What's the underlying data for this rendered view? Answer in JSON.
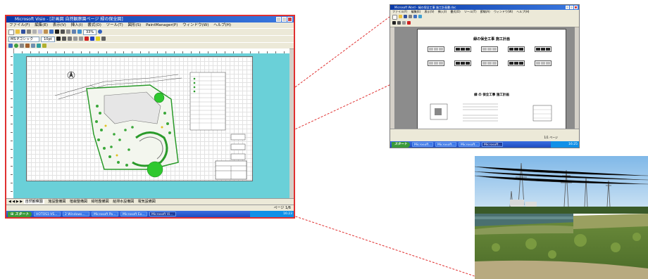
{
  "main_window": {
    "title": "Microsoft Visio - [計画図 自然観察園ページ 緑の保全図]",
    "menu": [
      "ファイル(F)",
      "編集(E)",
      "表示(V)",
      "挿入(I)",
      "書式(O)",
      "ツール(T)",
      "図形(S)",
      "PaintManager(P)",
      "ウィンドウ(W)",
      "ヘルプ(H)"
    ],
    "font_name": "MS Pゴシック",
    "font_size": "10pt",
    "zoom": "33%",
    "page_tabs": [
      "自然観察園",
      "施設整備図",
      "植栽整備図",
      "緑地整備図",
      "給排水設備図",
      "電気設備図"
    ],
    "status": "ページ 1/6",
    "taskbar": {
      "start_label": "スタート",
      "tasks": [
        "HOTOS1-VS...",
        "2 Windows...",
        "Microsoft Po...",
        "Microsoft Ex...",
        "Microsoft Vi..."
      ],
      "clock": "16:23"
    }
  },
  "doc_window": {
    "title": "Microsoft Word - 緑の保全工事 施工計画書.doc",
    "menu": [
      "ファイル(F)",
      "編集(E)",
      "表示(V)",
      "挿入(I)",
      "書式(O)",
      "ツール(T)",
      "罫線(A)",
      "ウィンドウ(W)",
      "ヘルプ(H)"
    ],
    "doc_heading": "緑の保全工事 施工計画",
    "doc_heading2": "緑 の 保全工事 施工計画",
    "status": "1/1 ページ",
    "taskbar": {
      "start_label": "スタート",
      "tasks": [
        "Microsoft...",
        "Microsoft...",
        "Microsoft...",
        "Microsoft..."
      ],
      "clock": "16:25"
    }
  },
  "colors": {
    "highlight_border": "#e03030",
    "connector_line": "#e03030",
    "visio_canvas": "#6ad0d8",
    "plan_green": "#2a9a2a"
  },
  "icons": [
    "visio-app-icon",
    "word-app-icon",
    "windows-start-icon"
  ]
}
